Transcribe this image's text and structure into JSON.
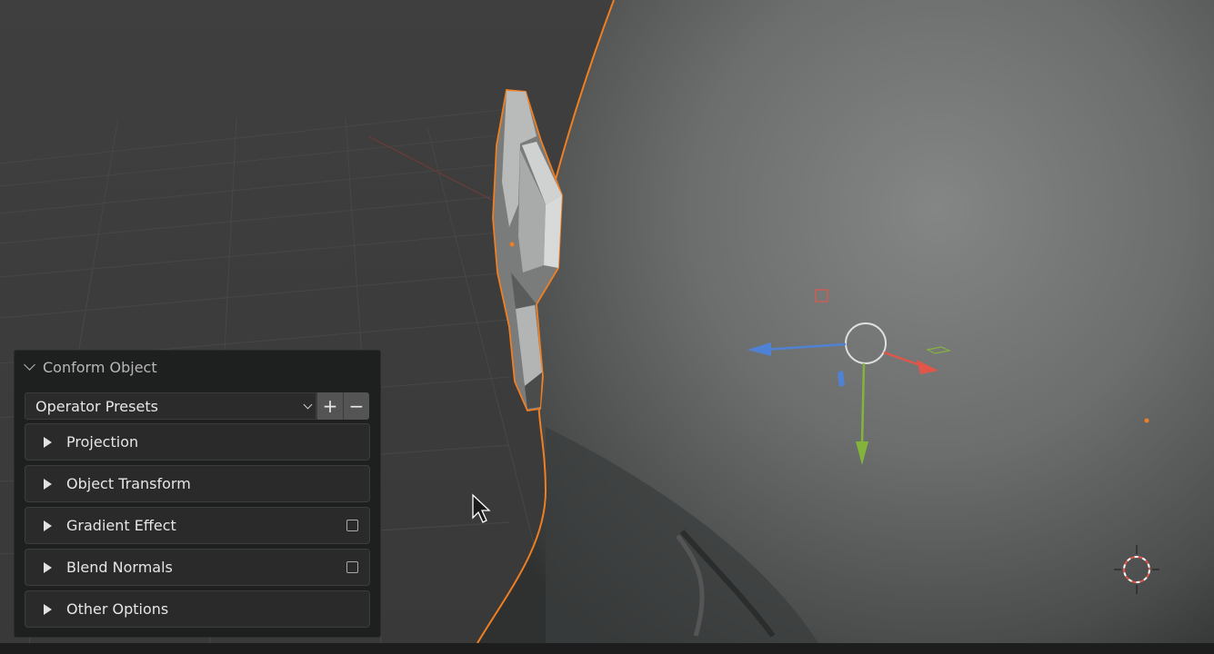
{
  "operator_panel": {
    "title": "Conform Object",
    "presets_label": "Operator Presets",
    "add_symbol": "+",
    "remove_symbol": "−",
    "sections": [
      {
        "label": "Projection",
        "has_checkbox": false
      },
      {
        "label": "Object Transform",
        "has_checkbox": false
      },
      {
        "label": "Gradient Effect",
        "has_checkbox": true,
        "checked": false
      },
      {
        "label": "Blend Normals",
        "has_checkbox": true,
        "checked": false
      },
      {
        "label": "Other Options",
        "has_checkbox": false
      }
    ]
  },
  "colors": {
    "selection_outline": "#f07f22",
    "axis_x": "#e0574a",
    "axis_y": "#84b33c",
    "axis_z": "#4f82d4"
  }
}
